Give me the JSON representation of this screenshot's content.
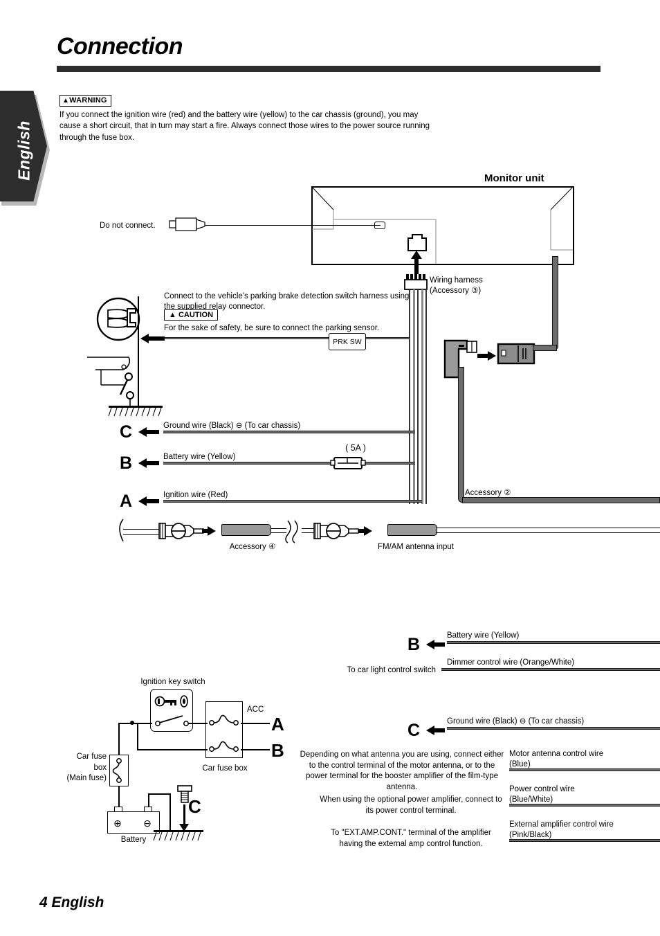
{
  "page": {
    "title": "Connection",
    "side_tab": "English",
    "footer": "4 English"
  },
  "warning": {
    "badge": "WARNING",
    "badge_icon": "warning-triangle-icon",
    "text": "If you connect the ignition wire (red) and the battery wire (yellow) to the car chassis (ground), you may cause a short circuit, that in turn may start a fire. Always connect those wires to the power source running through the fuse box."
  },
  "caution": {
    "badge": "CAUTION",
    "badge_icon": "caution-triangle-icon",
    "text": "For the sake of safety, be sure to connect the parking sensor."
  },
  "diagram_top": {
    "monitor_unit_label": "Monitor unit",
    "do_not_connect": "Do not connect.",
    "wiring_harness_line1": "Wiring harness",
    "wiring_harness_line2": "(Accessory ③)",
    "parking_instruction": "Connect to the vehicle's parking brake detection switch harness using the supplied relay connector.",
    "prk_sw": "PRK SW",
    "accessory_2": "Accessory ②",
    "wires": [
      {
        "letter": "C",
        "label": "Ground wire (Black) ⊖ (To car chassis)"
      },
      {
        "letter": "B",
        "label": "Battery wire (Yellow)",
        "fuse": "( 5A )"
      },
      {
        "letter": "A",
        "label": "Ignition wire (Red)"
      }
    ],
    "antenna": {
      "accessory_4": "Accessory ④",
      "fm_am_input": "FM/AM antenna input"
    }
  },
  "diagram_bottom_left": {
    "ignition_key_switch": "Ignition key switch",
    "acc": "ACC",
    "car_fuse_box": "Car fuse box",
    "main_fuse_line1": "Car fuse",
    "main_fuse_line2": "box",
    "main_fuse_line3": "(Main fuse)",
    "battery": "Battery",
    "letters": {
      "a": "A",
      "b": "B",
      "c": "C"
    },
    "battery_plus": "⊕",
    "battery_minus": "⊖"
  },
  "diagram_bottom_right": {
    "rows": [
      {
        "letter": "B",
        "left_note": "",
        "wire_label": "Battery wire (Yellow)"
      },
      {
        "letter": "",
        "left_note": "To car light control switch",
        "wire_label": "Dimmer control wire (Orange/White)"
      },
      {
        "letter": "C",
        "left_note": "",
        "wire_label": "Ground wire (Black) ⊖ (To car chassis)"
      },
      {
        "letter": "",
        "left_note": "Depending on what antenna you are using, connect either to the control terminal of the motor antenna, or to the power terminal for the booster amplifier of the film-type antenna.",
        "wire_label": "Motor antenna control wire",
        "wire_label2": "(Blue)"
      },
      {
        "letter": "",
        "left_note": "When using the optional power amplifier, connect to its power control terminal.",
        "wire_label": "Power control wire",
        "wire_label2": "(Blue/White)"
      },
      {
        "letter": "",
        "left_note": "To \"EXT.AMP.CONT.\" terminal of the amplifier having the external amp control function.",
        "wire_label": "External amplifier control wire",
        "wire_label2": "(Pink/Black)"
      }
    ]
  },
  "colors": {
    "rule": "#2d2d2d",
    "tab_bg": "#2d2d2d",
    "wire_gray": "#6d6d6d",
    "connector_gray": "#9a9a9a"
  }
}
